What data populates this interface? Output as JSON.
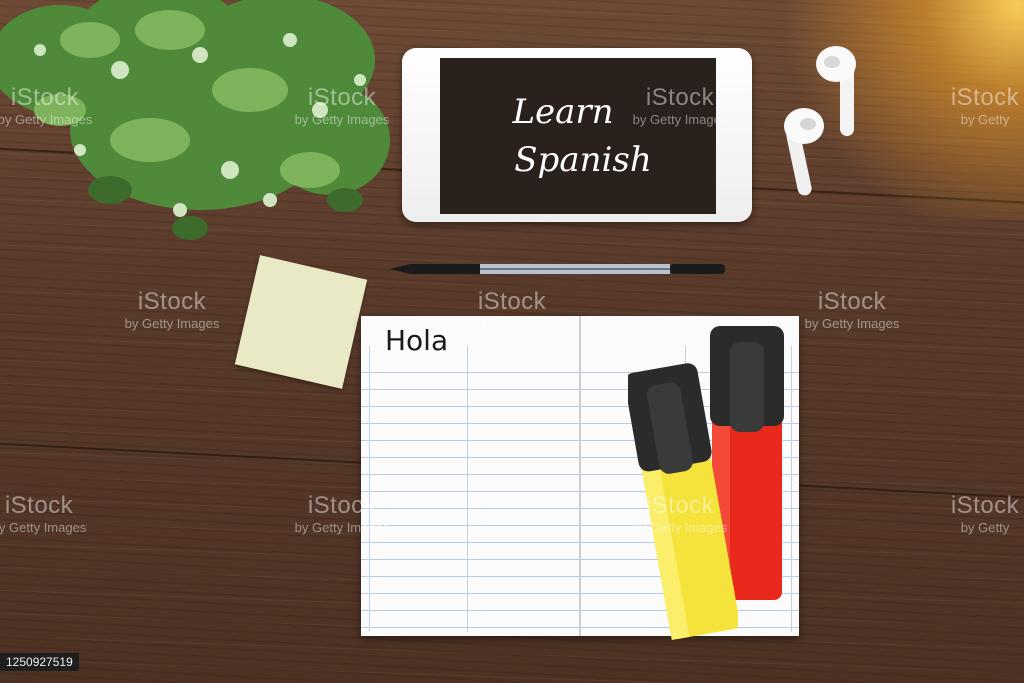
{
  "phone_screen": {
    "line1": "Learn",
    "line2": "Spanish"
  },
  "notebook": {
    "heading": "Hola"
  },
  "watermark": {
    "brand": "iStock",
    "sub": "by Getty Images",
    "sub_short": "by Getty",
    "brand_right": "iStock"
  },
  "image_id": "1250927519",
  "colors": {
    "wood": "#5a3b2b",
    "phone_screen": "#2a211d",
    "marker_yellow": "#f5e23a",
    "marker_red": "#e8291b",
    "sticky_note": "#eae9c6"
  },
  "icons": [
    "potted-plant",
    "smartphone",
    "earbuds",
    "ballpoint-pen",
    "sticky-note",
    "notebook",
    "yellow-highlighter",
    "red-highlighter"
  ]
}
